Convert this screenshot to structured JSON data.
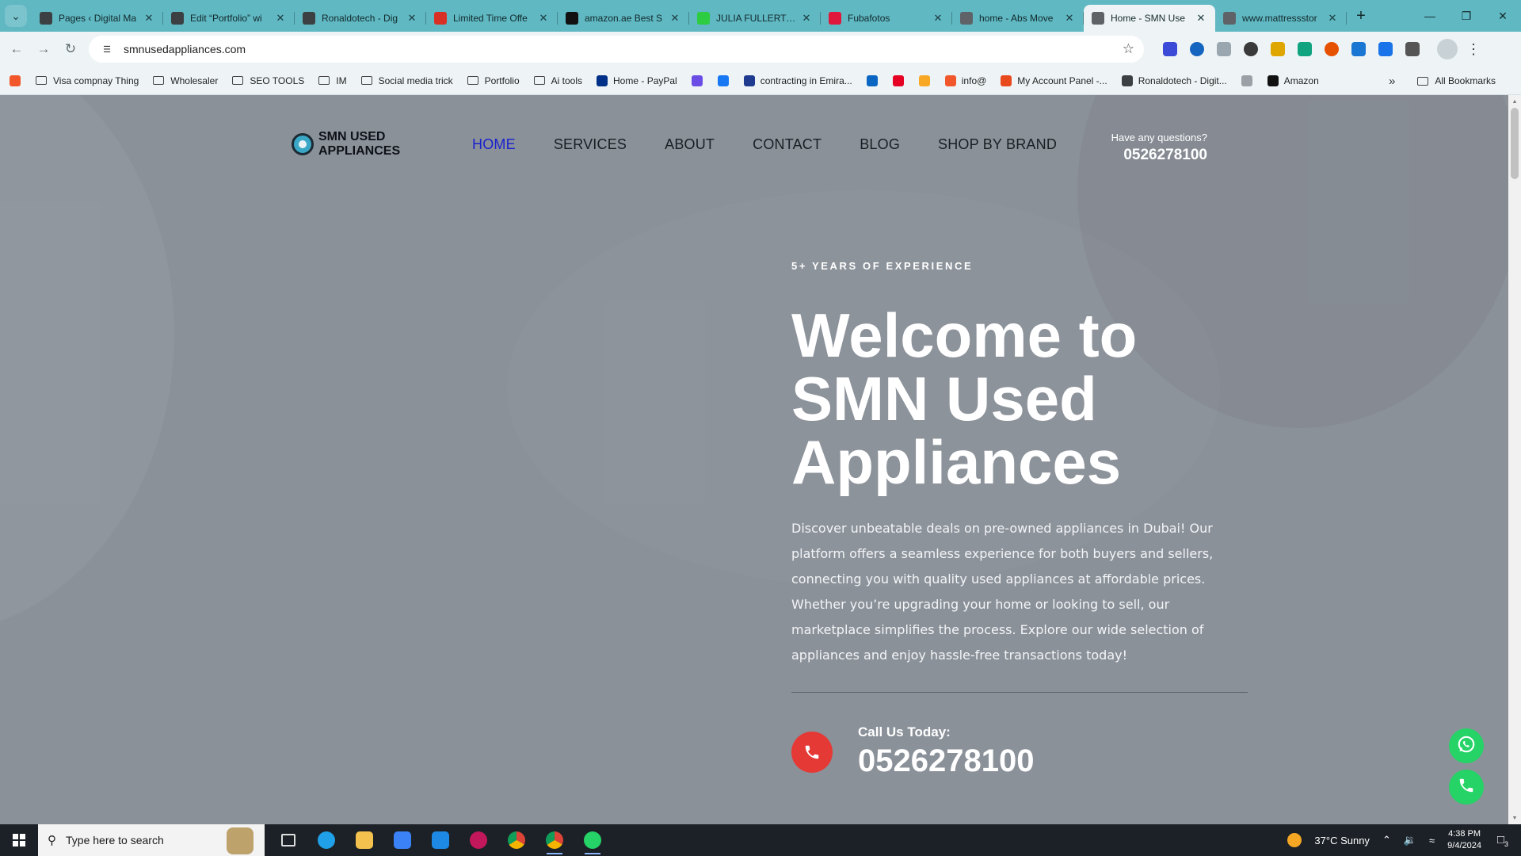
{
  "browser": {
    "tabs": [
      {
        "title": "Pages ‹ Digital Ma",
        "icon_color": "#3c4043",
        "active": false
      },
      {
        "title": "Edit “Portfolio” wi",
        "icon_color": "#3c4043",
        "active": false
      },
      {
        "title": "Ronaldotech - Dig",
        "icon_color": "#3c4043",
        "active": false
      },
      {
        "title": "Limited Time Offe",
        "icon_color": "#d93025",
        "active": false
      },
      {
        "title": "amazon.ae Best S",
        "icon_color": "#111111",
        "active": false
      },
      {
        "title": "JULIA FULLERTON",
        "icon_color": "#2ecc40",
        "active": false
      },
      {
        "title": "Fubafotos",
        "icon_color": "#e0173a",
        "active": false
      },
      {
        "title": "home - Abs Move",
        "icon_color": "#5f6368",
        "active": false
      },
      {
        "title": "Home - SMN Use",
        "icon_color": "#5f6368",
        "active": true
      },
      {
        "title": "www.mattressstor",
        "icon_color": "#5f6368",
        "active": false
      }
    ],
    "url": "smnusedappliances.com",
    "bookmarks": [
      {
        "label": "",
        "type": "icon",
        "icon_color": "#f2572b"
      },
      {
        "label": "Visa compnay Thing",
        "type": "folder"
      },
      {
        "label": "Wholesaler",
        "type": "folder"
      },
      {
        "label": "SEO TOOLS",
        "type": "folder"
      },
      {
        "label": "IM",
        "type": "folder"
      },
      {
        "label": "Social media trick",
        "type": "folder"
      },
      {
        "label": "Portfolio",
        "type": "folder"
      },
      {
        "label": "Ai tools",
        "type": "folder"
      },
      {
        "label": "Home - PayPal",
        "type": "icon",
        "icon_color": "#003087"
      },
      {
        "label": "",
        "type": "icon",
        "icon_color": "#6b4de6"
      },
      {
        "label": "",
        "type": "icon",
        "icon_color": "#1877f2"
      },
      {
        "label": "contracting in Emira...",
        "type": "icon",
        "icon_color": "#1f3b8f"
      },
      {
        "label": "",
        "type": "icon",
        "icon_color": "#0a66c2"
      },
      {
        "label": "",
        "type": "icon",
        "icon_color": "#e60023"
      },
      {
        "label": "",
        "type": "icon",
        "icon_color": "#f9a825"
      },
      {
        "label": "info@",
        "type": "icon",
        "icon_color": "#f2572b"
      },
      {
        "label": "My Account Panel -...",
        "type": "icon",
        "icon_color": "#e8491d"
      },
      {
        "label": "Ronaldotech - Digit...",
        "type": "icon",
        "icon_color": "#3c4043"
      },
      {
        "label": "",
        "type": "icon",
        "icon_color": "#9aa0a6"
      },
      {
        "label": "Amazon",
        "type": "icon",
        "icon_color": "#111111"
      }
    ],
    "all_bookmarks_label": "All Bookmarks"
  },
  "site": {
    "logo_line1": "SMN USED",
    "logo_line2": "APPLIANCES",
    "nav": [
      {
        "label": "HOME",
        "active": true
      },
      {
        "label": "SERVICES",
        "active": false
      },
      {
        "label": "ABOUT",
        "active": false
      },
      {
        "label": "CONTACT",
        "active": false
      },
      {
        "label": "BLOG",
        "active": false
      },
      {
        "label": "SHOP BY BRAND",
        "active": false
      }
    ],
    "questions_label": "Have any questions?",
    "questions_phone": "0526278100",
    "hero": {
      "eyebrow": "5+ YEARS OF EXPERIENCE",
      "title_line1": "Welcome to",
      "title_line2": "SMN Used",
      "title_line3": "Appliances",
      "body": "Discover unbeatable deals on pre-owned appliances in Dubai! Our platform offers a seamless experience for both buyers and sellers, connecting you with quality used appliances at affordable prices. Whether you’re upgrading your home or looking to sell, our marketplace simplifies the process. Explore our wide selection of appliances and enjoy hassle-free transactions today!",
      "call_label": "Call Us Today:",
      "call_number": "0526278100"
    }
  },
  "taskbar": {
    "search_placeholder": "Type here to search",
    "weather": "37°C  Sunny",
    "time": "4:38 PM",
    "date": "9/4/2024",
    "notification_count": "3"
  },
  "colors": {
    "accent_nav": "#1a22cf",
    "call_red": "#e53935",
    "whatsapp_green": "#25d366",
    "tabstrip": "#5fb8c2"
  }
}
